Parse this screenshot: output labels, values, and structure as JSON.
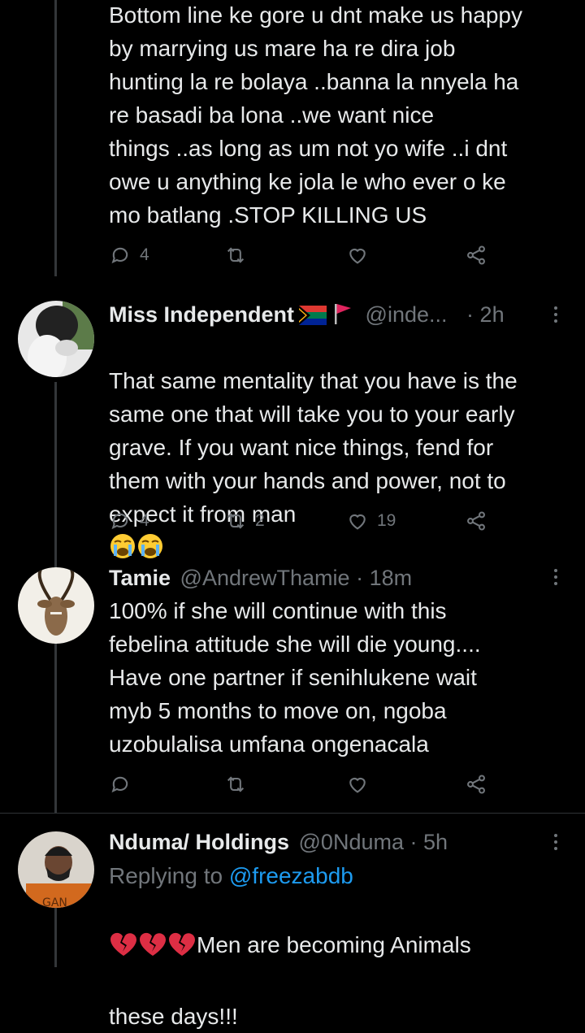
{
  "tweets": [
    {
      "text": "Bottom line ke gore u dnt make us happy\nby marrying us mare ha re dira job\nhunting la re bolaya ..banna la nnyela ha\nre basadi ba lona ..we want nice\nthings ..as long as um not yo wife ..i dnt\nowe u anything ke jola le who ever o ke\nmo batlang .STOP KILLING US",
      "reply_count": "4",
      "retweet_count": "",
      "like_count": ""
    },
    {
      "name": "Miss Independent",
      "handle": "@inde...",
      "dot": "·",
      "time": "2h",
      "text": "That same mentality that you have is the\nsame one that will take you to your early\ngrave. If you want nice things, fend for\nthem with your hands and power, not to\nexpect it from man",
      "reply_count": "4",
      "retweet_count": "2",
      "like_count": "19"
    },
    {
      "name": "Tamie",
      "handle": "@AndrewThamie",
      "dot": "·",
      "time": "18m",
      "text": "100% if she will continue with this\nfebelina attitude she will die young....\nHave one partner if senihlukene wait\nmyb 5 months to move on, ngoba\nuzobulalisa umfana ongenacala",
      "reply_count": "",
      "retweet_count": "",
      "like_count": ""
    },
    {
      "name": "Nduma/ Holdings",
      "handle": "@0Nduma",
      "dot": "·",
      "time": "5h",
      "replying_label": "Replying to",
      "replying_handle": "@freezabdb",
      "text_line1": "Men are becoming Animals",
      "text_line2": "these days!!!"
    }
  ],
  "colors": {
    "background": "#000000",
    "text": "#e7e9ea",
    "secondary": "#71767b",
    "link": "#1d9bf0",
    "divider": "#2f3336"
  }
}
